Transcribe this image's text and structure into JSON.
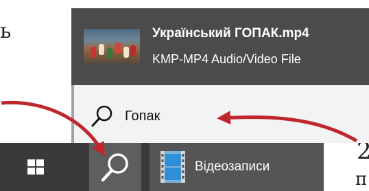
{
  "fragments": {
    "top_left": "ь",
    "step_number": "2",
    "bottom_right": "п"
  },
  "search_result": {
    "title": "Український ГОПАК.mp4",
    "subtitle": "KMP-MP4 Audio/Video File",
    "thumbnail_icon": "dance-video-thumbnail"
  },
  "search_box": {
    "query": "Гопак",
    "icon": "search-icon"
  },
  "taskbar": {
    "start_icon": "windows-logo-icon",
    "search_icon": "search-icon",
    "videos_label": "Відеозаписи",
    "videos_icon": "video-folder-icon"
  },
  "colors": {
    "panel": "#4b4b4b",
    "search_box": "#f3f3f3",
    "taskbar": "#3a3a3a",
    "active_search_button": "#5e5e5e",
    "annotation_arrow": "#c0272d"
  }
}
